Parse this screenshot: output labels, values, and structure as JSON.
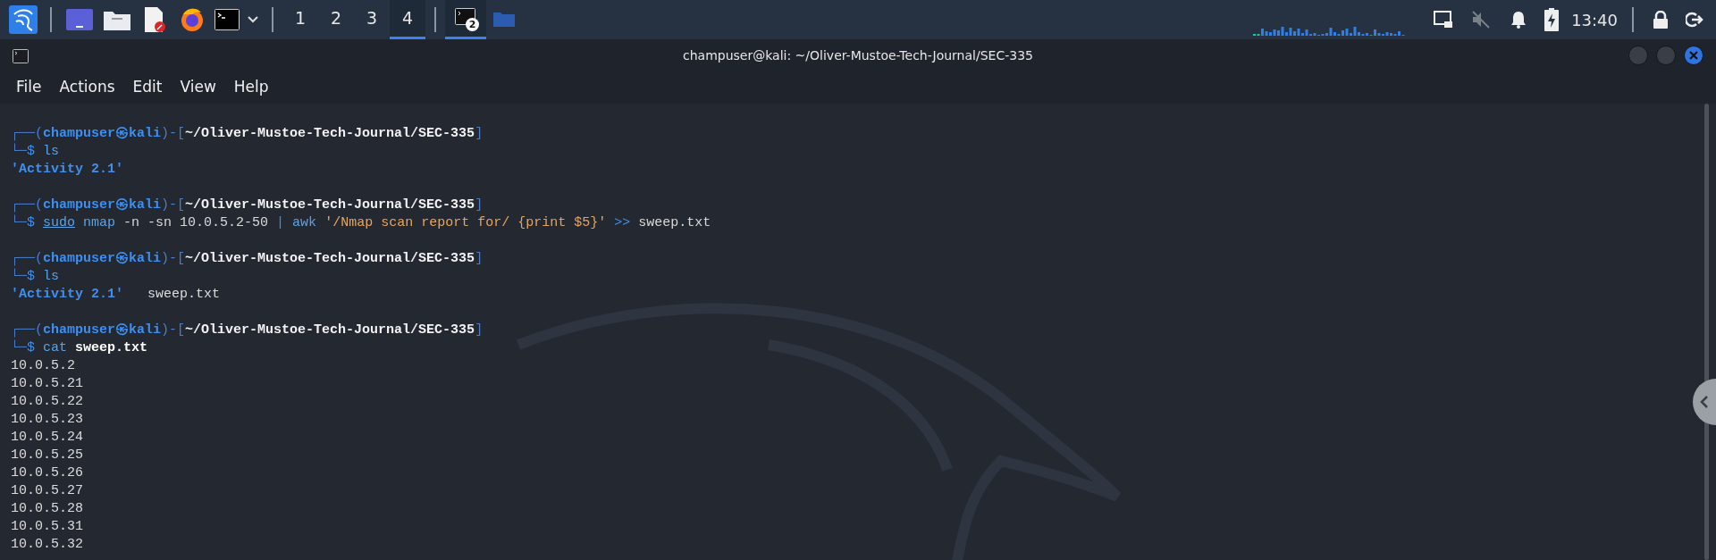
{
  "taskbar": {
    "workspaces": [
      {
        "label": "1",
        "selected": false
      },
      {
        "label": "2",
        "selected": false
      },
      {
        "label": "3",
        "selected": false
      },
      {
        "label": "4",
        "selected": true
      }
    ],
    "window_button": {
      "badge": "2",
      "selected": true
    },
    "clock": "13:40"
  },
  "window": {
    "title": "champuser@kali: ~/Oliver-Mustoe-Tech-Journal/SEC-335",
    "menu": [
      "File",
      "Actions",
      "Edit",
      "View",
      "Help"
    ]
  },
  "terminal": {
    "blocks": [
      {
        "prompt": [
          {
            "kind": "frame",
            "text": "┌──("
          },
          {
            "kind": "user",
            "text": "champuser㉿kali"
          },
          {
            "kind": "frame",
            "text": ")-["
          },
          {
            "kind": "path",
            "text": "~/Oliver-Mustoe-Tech-Journal/SEC-335"
          },
          {
            "kind": "frame",
            "text": "]"
          }
        ],
        "command": [
          {
            "kind": "frame",
            "text": "└─"
          },
          {
            "kind": "op",
            "text": "$ "
          },
          {
            "kind": "cmd",
            "text": "ls"
          }
        ],
        "output": [
          [
            {
              "kind": "dir",
              "text": "'Activity 2.1'"
            }
          ]
        ]
      },
      {
        "prompt": [
          {
            "kind": "frame",
            "text": "┌──("
          },
          {
            "kind": "user",
            "text": "champuser㉿kali"
          },
          {
            "kind": "frame",
            "text": ")-["
          },
          {
            "kind": "path",
            "text": "~/Oliver-Mustoe-Tech-Journal/SEC-335"
          },
          {
            "kind": "frame",
            "text": "]"
          }
        ],
        "command": [
          {
            "kind": "frame",
            "text": "└─"
          },
          {
            "kind": "op",
            "text": "$ "
          },
          {
            "kind": "sudo",
            "text": "sudo"
          },
          {
            "kind": "cmd",
            "text": " nmap"
          },
          {
            "kind": "arg",
            "text": " -n -sn 10.0.5.2-50 "
          },
          {
            "kind": "op",
            "text": "|"
          },
          {
            "kind": "cmd",
            "text": " awk "
          },
          {
            "kind": "string",
            "text": "'/Nmap scan report for/ {print $5}'"
          },
          {
            "kind": "op",
            "text": " >>"
          },
          {
            "kind": "arg",
            "text": " sweep.txt"
          }
        ]
      },
      {
        "prompt": [
          {
            "kind": "frame",
            "text": "┌──("
          },
          {
            "kind": "user",
            "text": "champuser㉿kali"
          },
          {
            "kind": "frame",
            "text": ")-["
          },
          {
            "kind": "path",
            "text": "~/Oliver-Mustoe-Tech-Journal/SEC-335"
          },
          {
            "kind": "frame",
            "text": "]"
          }
        ],
        "command": [
          {
            "kind": "frame",
            "text": "└─"
          },
          {
            "kind": "op",
            "text": "$ "
          },
          {
            "kind": "cmd",
            "text": "ls"
          }
        ],
        "output": [
          [
            {
              "kind": "dir",
              "text": "'Activity 2.1'"
            },
            {
              "kind": "plain",
              "text": "   sweep.txt"
            }
          ]
        ]
      },
      {
        "prompt": [
          {
            "kind": "frame",
            "text": "┌──("
          },
          {
            "kind": "user",
            "text": "champuser㉿kali"
          },
          {
            "kind": "frame",
            "text": ")-["
          },
          {
            "kind": "path",
            "text": "~/Oliver-Mustoe-Tech-Journal/SEC-335"
          },
          {
            "kind": "frame",
            "text": "]"
          }
        ],
        "command": [
          {
            "kind": "frame",
            "text": "└─"
          },
          {
            "kind": "op",
            "text": "$ "
          },
          {
            "kind": "cmd",
            "text": "cat "
          },
          {
            "kind": "file",
            "text": "sweep.txt"
          }
        ],
        "output": [
          [
            {
              "kind": "plain",
              "text": "10.0.5.2"
            }
          ],
          [
            {
              "kind": "plain",
              "text": "10.0.5.21"
            }
          ],
          [
            {
              "kind": "plain",
              "text": "10.0.5.22"
            }
          ],
          [
            {
              "kind": "plain",
              "text": "10.0.5.23"
            }
          ],
          [
            {
              "kind": "plain",
              "text": "10.0.5.24"
            }
          ],
          [
            {
              "kind": "plain",
              "text": "10.0.5.25"
            }
          ],
          [
            {
              "kind": "plain",
              "text": "10.0.5.26"
            }
          ],
          [
            {
              "kind": "plain",
              "text": "10.0.5.27"
            }
          ],
          [
            {
              "kind": "plain",
              "text": "10.0.5.28"
            }
          ],
          [
            {
              "kind": "plain",
              "text": "10.0.5.31"
            }
          ],
          [
            {
              "kind": "plain",
              "text": "10.0.5.32"
            }
          ]
        ]
      }
    ]
  }
}
